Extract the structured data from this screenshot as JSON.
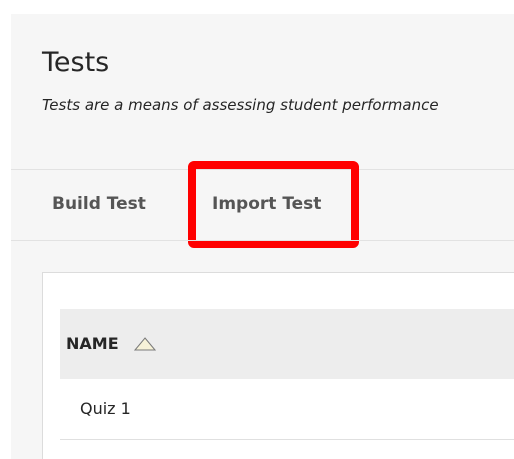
{
  "header": {
    "title": "Tests",
    "subtitle": "Tests are a means of assessing student performance"
  },
  "actions": {
    "build_label": "Build Test",
    "import_label": "Import Test"
  },
  "table": {
    "columns": [
      {
        "label": "NAME",
        "sort": "ascending",
        "sort_icon": "triangle-up-icon"
      }
    ],
    "rows": [
      {
        "name": "Quiz 1"
      }
    ]
  },
  "annotation": {
    "highlight_color": "#ff0000",
    "highlighted_item": "Import Test"
  }
}
